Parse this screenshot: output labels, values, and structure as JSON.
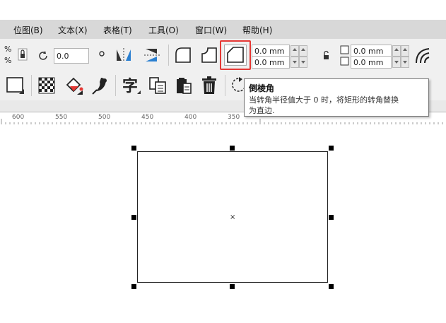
{
  "menu": {
    "items": [
      {
        "label": "位图(B)"
      },
      {
        "label": "文本(X)"
      },
      {
        "label": "表格(T)"
      },
      {
        "label": "工具(O)"
      },
      {
        "label": "窗口(W)"
      },
      {
        "label": "帮助(H)"
      }
    ]
  },
  "property_bar": {
    "rotation_value": "0.0",
    "corner_width_top": "0.0 mm",
    "corner_width_bottom": "0.0 mm",
    "corner_height_top": "0.0 mm",
    "corner_height_bottom": "0.0 mm",
    "percent_symbol": "%",
    "icons": [
      "lock-ratio-icon",
      "rotate-icon",
      "degree-icon",
      "mirror-horizontal-icon",
      "mirror-vertical-icon",
      "round-corner-icon",
      "scallop-corner-icon",
      "chamfer-corner-icon",
      "link-icon",
      "relative-corner-scaling-icon"
    ]
  },
  "toolbar2": {
    "icons": [
      "rectangle-icon",
      "transparency-icon",
      "fill-icon",
      "eyedropper-icon",
      "text-icon",
      "paragraph-text-icon",
      "paste-icon",
      "trash-icon",
      "rotate-arrow-icon"
    ]
  },
  "ruler": {
    "ticks": [
      "600",
      "550",
      "500",
      "450",
      "400",
      "350"
    ]
  },
  "tooltip": {
    "title": "倒棱角",
    "line1": "当转角半径值大于 0 时，将矩形的转角替换",
    "line2": "为直边."
  },
  "colors": {
    "highlight": "#e53935",
    "menubar": "#d8d8d8",
    "toolbar": "#f0f0f0"
  }
}
